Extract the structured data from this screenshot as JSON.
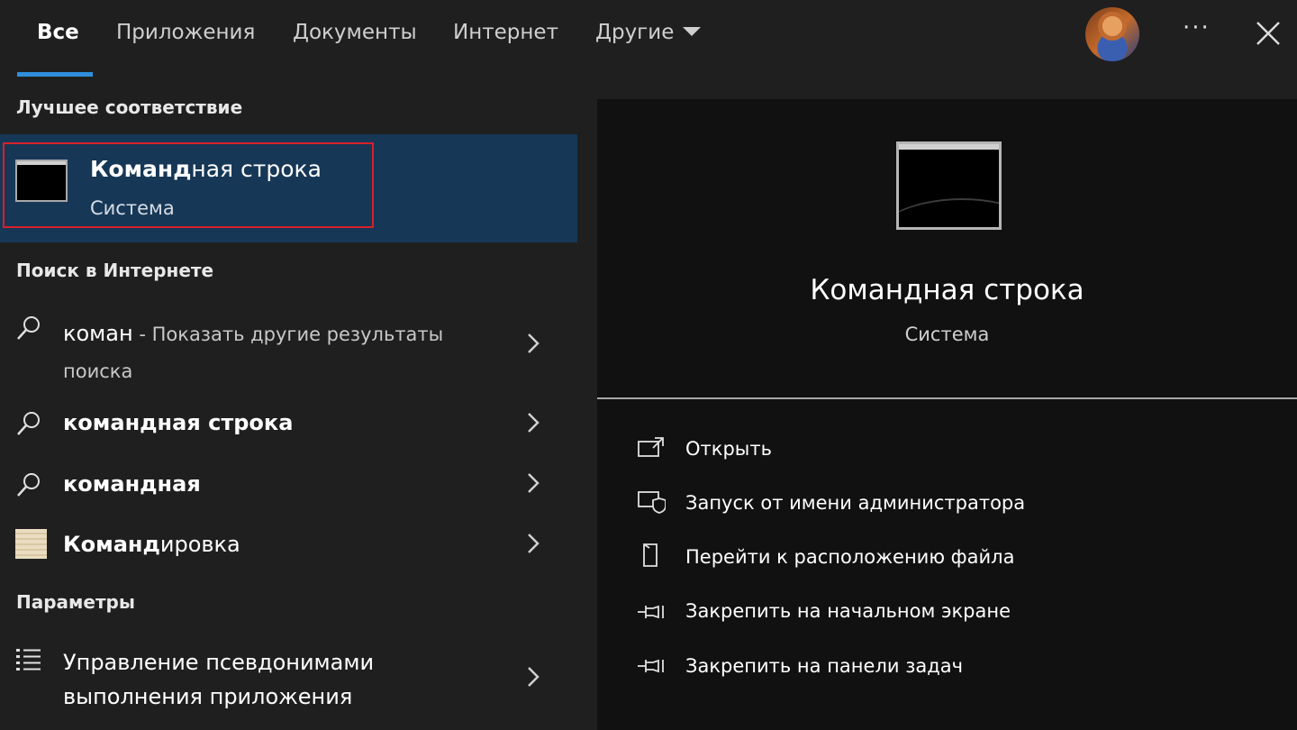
{
  "tabs": [
    {
      "label": "Все"
    },
    {
      "label": "Приложения"
    },
    {
      "label": "Документы"
    },
    {
      "label": "Интернет"
    },
    {
      "label": "Другие"
    }
  ],
  "topbar": {
    "more_label": "···"
  },
  "left": {
    "best_match_title": "Лучшее соответствие",
    "best_match": {
      "name_bold": "Команд",
      "name_rest": "ная строка",
      "subtitle": "Система"
    },
    "web_title": "Поиск в Интернете",
    "web_results": [
      {
        "query": "коман",
        "suffix": " - Показать другие результаты",
        "suffix2": "поиска"
      },
      {
        "bold": "командная строка"
      },
      {
        "bold": "командная"
      }
    ],
    "doc_result": {
      "bold": "Команд",
      "rest": "ировка"
    },
    "settings_title": "Параметры",
    "settings_item": {
      "line1": "Управление псевдонимами",
      "line2": "выполнения приложения"
    }
  },
  "right": {
    "app_title": "Командная строка",
    "app_subtitle": "Система",
    "actions": [
      {
        "label": "Открыть",
        "icon": "open-icon"
      },
      {
        "label": "Запуск от имени администратора",
        "icon": "admin-shield-icon"
      },
      {
        "label": "Перейти к расположению файла",
        "icon": "file-location-icon"
      },
      {
        "label": "Закрепить на начальном экране",
        "icon": "pin-icon"
      },
      {
        "label": "Закрепить на панели задач",
        "icon": "pin-icon"
      }
    ]
  },
  "colors": {
    "selection": "#173756",
    "highlight_border": "#d8202a",
    "accent": "#2f8fdc"
  }
}
